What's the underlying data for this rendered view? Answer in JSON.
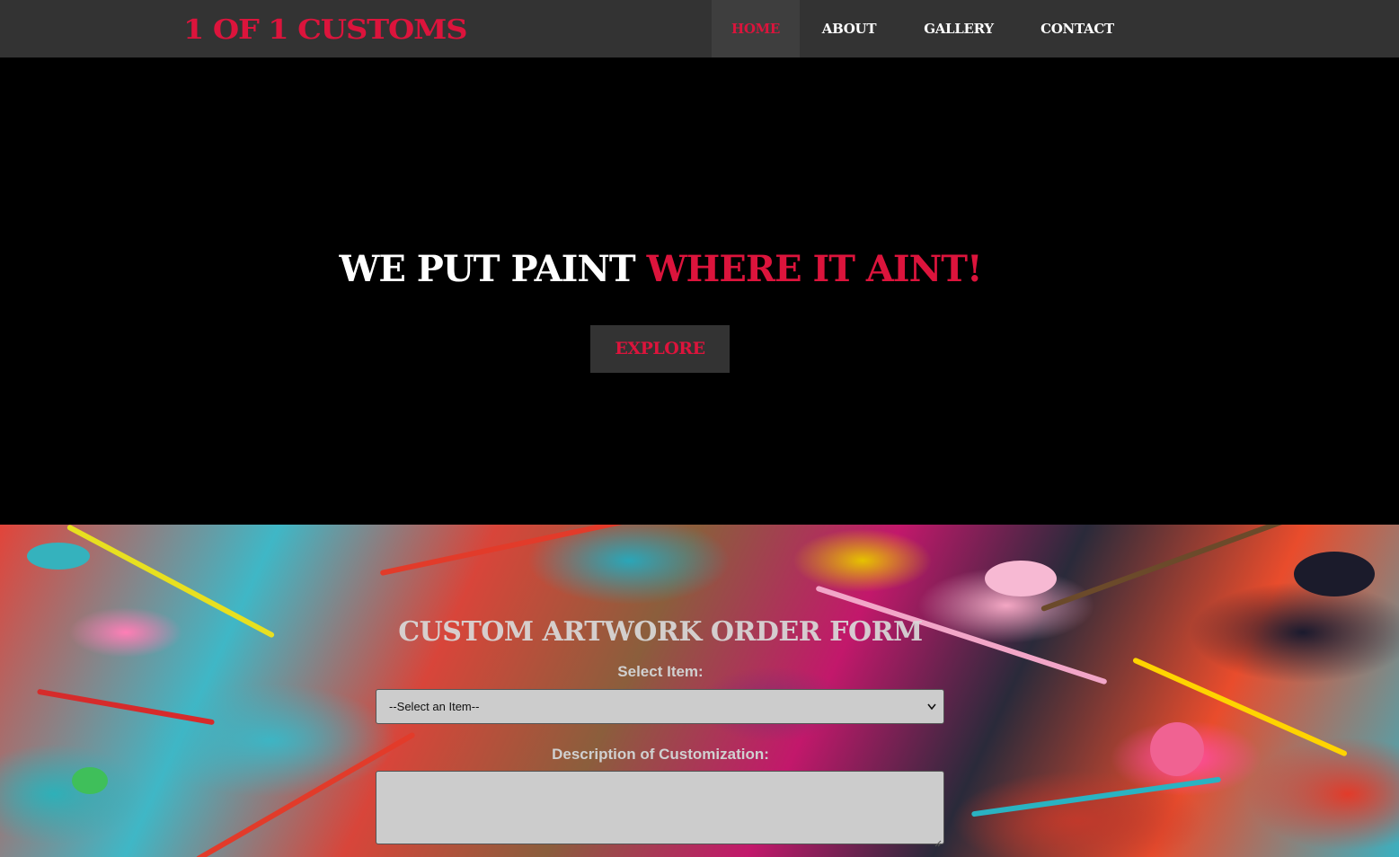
{
  "brand": {
    "name": "1 OF 1 CUSTOMS",
    "color": "#dc143c"
  },
  "nav": {
    "items": [
      {
        "label": "HOME",
        "active": true
      },
      {
        "label": "ABOUT",
        "active": false
      },
      {
        "label": "GALLERY",
        "active": false
      },
      {
        "label": "CONTACT",
        "active": false
      }
    ]
  },
  "hero": {
    "headline_white": "WE PUT PAINT ",
    "headline_red": "WHERE IT AINT!",
    "button_label": "EXPLORE"
  },
  "order_form": {
    "title": "CUSTOM ARTWORK ORDER FORM",
    "item_label": "Select Item:",
    "item_selected": "--Select an Item--",
    "description_label": "Description of Customization:",
    "description_value": ""
  },
  "colors": {
    "accent": "#dc143c",
    "navbar_bg": "#333333",
    "hero_bg": "#000000",
    "field_bg": "#cccccc"
  }
}
